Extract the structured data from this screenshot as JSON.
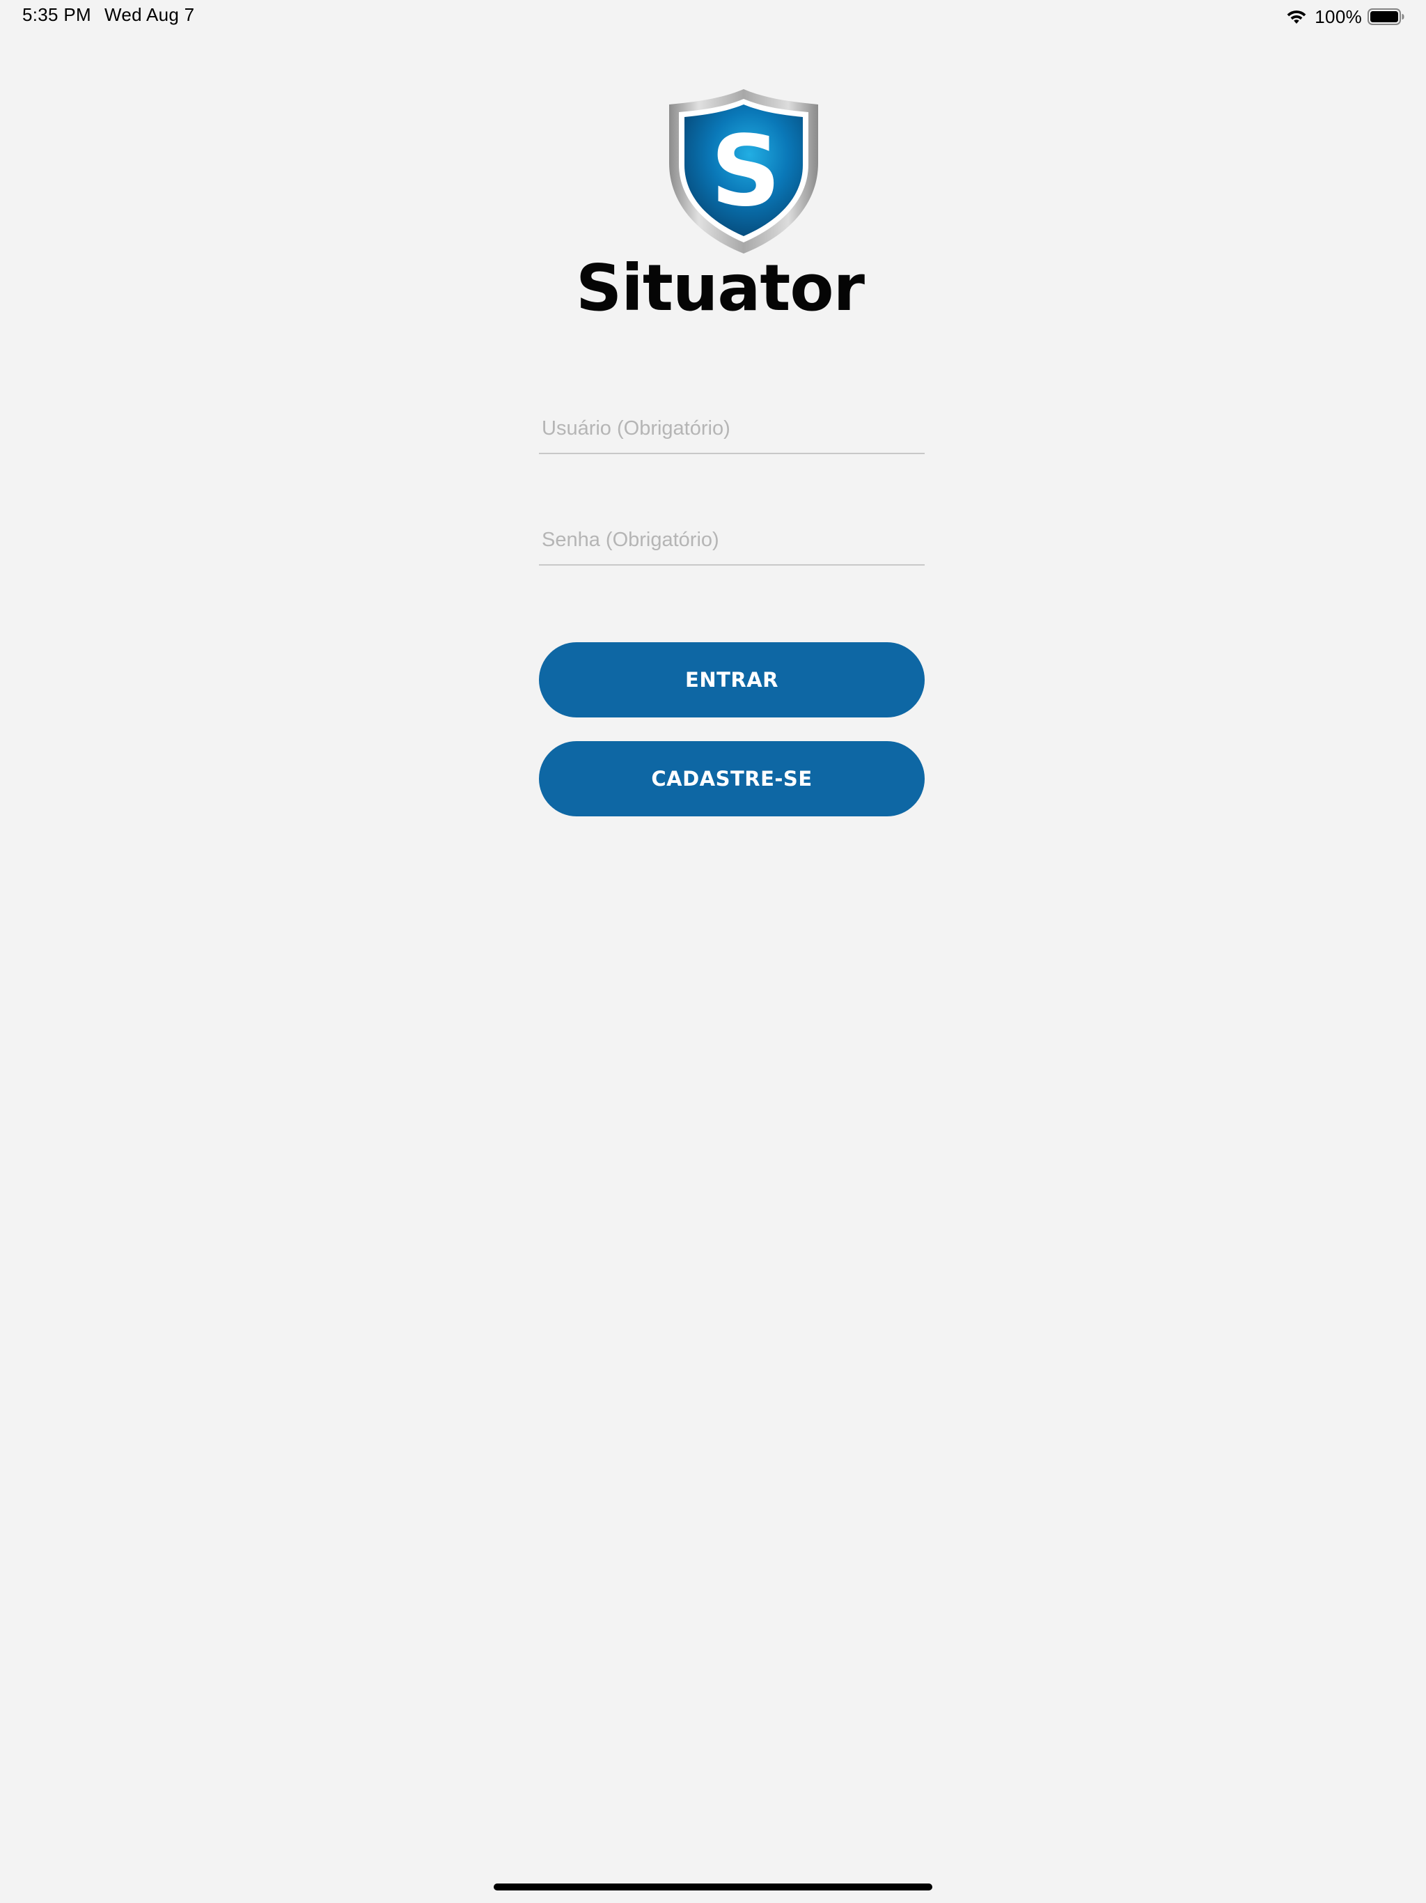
{
  "status_bar": {
    "time": "5:35 PM",
    "date": "Wed Aug 7",
    "battery_percent": "100%",
    "battery_level": 1.0,
    "icons": [
      "wifi-icon",
      "battery-icon"
    ]
  },
  "logo": {
    "letter": "S",
    "brand_name": "Situator",
    "colors": {
      "shield_blue": "#0a6fae",
      "shield_light": "#1aa0d8",
      "shield_silver": "#b8b8b8"
    }
  },
  "login_form": {
    "username_placeholder": "Usuário (Obrigatório)",
    "username_value": "",
    "password_placeholder": "Senha (Obrigatório)",
    "password_value": "",
    "enter_label": "ENTRAR",
    "register_label": "CADASTRE-SE"
  },
  "colors": {
    "background": "#f3f3f3",
    "button": "#0e67a4",
    "button_text": "#ffffff",
    "placeholder": "#b5b5b5",
    "field_underline": "#c8c8c8"
  }
}
